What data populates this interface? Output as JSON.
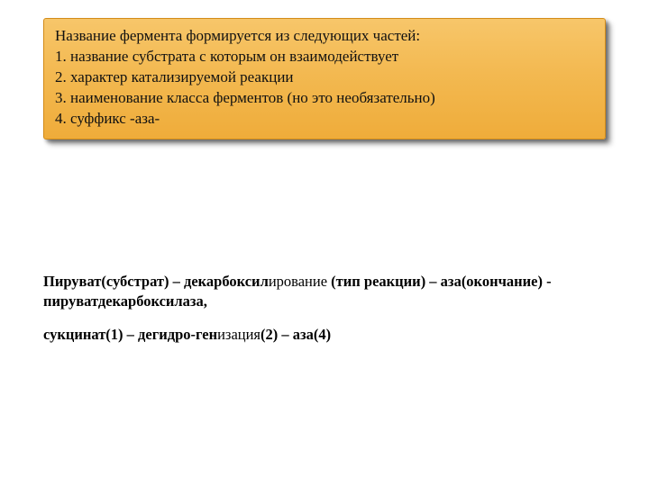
{
  "callout": {
    "heading": "Название фермента формируется из следующих частей:",
    "items": [
      "1. название субстрата с которым он взаимодействует",
      "2. характер катализируемой реакции",
      "3. наименование класса ферментов (но это необязательно)",
      "4. суффикс -аза-"
    ]
  },
  "examples": {
    "line1": {
      "b1": "Пируват(субстрат) – декарбоксил",
      "n1": "ирование",
      "b2": " (тип реакции) – аза(окончание) - пируватдекарбоксилаза,"
    },
    "line2": {
      "b1": "сукцинат(1) – дегидро-ген",
      "n1": "изация",
      "b2": "(2) – аза(4)"
    }
  }
}
